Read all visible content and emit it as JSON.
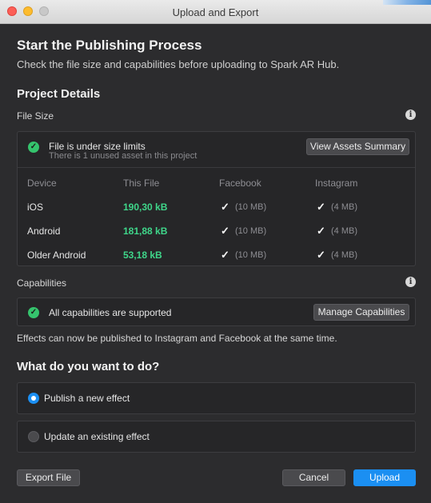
{
  "window": {
    "title": "Upload and Export"
  },
  "header": {
    "title": "Start the Publishing Process",
    "subtitle": "Check the file size and capabilities before uploading to Spark AR Hub."
  },
  "project_details": {
    "title": "Project Details",
    "file_size": {
      "label": "File Size",
      "status": "File is under size limits",
      "note": "There is 1 unused asset in this project",
      "view_button": "View Assets Summary",
      "columns": [
        "Device",
        "This File",
        "Facebook",
        "Instagram"
      ],
      "rows": [
        {
          "device": "iOS",
          "size": "190,30 kB",
          "facebook": "(10 MB)",
          "instagram": "(4 MB)"
        },
        {
          "device": "Android",
          "size": "181,88 kB",
          "facebook": "(10 MB)",
          "instagram": "(4 MB)"
        },
        {
          "device": "Older Android",
          "size": "53,18 kB",
          "facebook": "(10 MB)",
          "instagram": "(4 MB)"
        }
      ],
      "check_glyph": "✓"
    },
    "capabilities": {
      "label": "Capabilities",
      "status": "All capabilities are supported",
      "manage_button": "Manage Capabilities",
      "note": "Effects can now be published to Instagram and Facebook at the same time."
    }
  },
  "action": {
    "title": "What do you want to do?",
    "options": [
      {
        "label": "Publish a new effect",
        "selected": true
      },
      {
        "label": "Update an existing effect",
        "selected": false
      }
    ]
  },
  "footer": {
    "export_label": "Export File",
    "cancel_label": "Cancel",
    "upload_label": "Upload"
  },
  "icons": {
    "info": "i",
    "check": "✓"
  },
  "colors": {
    "accent": "#1b8ff2",
    "success": "#35c46d",
    "size_value": "#3fd68a"
  }
}
